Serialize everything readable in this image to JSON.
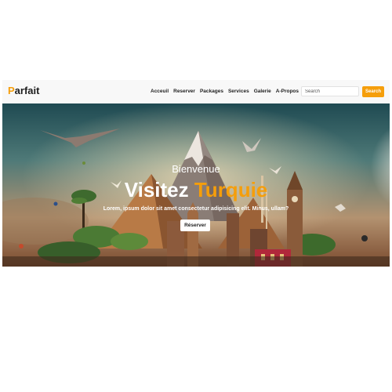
{
  "brand": {
    "logo_first_letter": "P",
    "logo_rest": "arfait"
  },
  "nav": {
    "items": [
      {
        "label": "Acceuil"
      },
      {
        "label": "Reserver"
      },
      {
        "label": "Packages"
      },
      {
        "label": "Services"
      },
      {
        "label": "Galerie"
      },
      {
        "label": "A-Propos"
      }
    ],
    "search_placeholder": "Search",
    "search_button_label": "Search"
  },
  "hero": {
    "welcome": "Bienvenue",
    "title_part1": "Visitez ",
    "title_accent": "Turquie",
    "description": "Lorem, ipsum dolor sit amet consectetur adipisicing elit. Minus, ullam?",
    "button_label": "Réserver"
  },
  "colors": {
    "accent": "#f59e0b",
    "navbar_background": "#f8f8f8",
    "text_dark": "#222222"
  }
}
